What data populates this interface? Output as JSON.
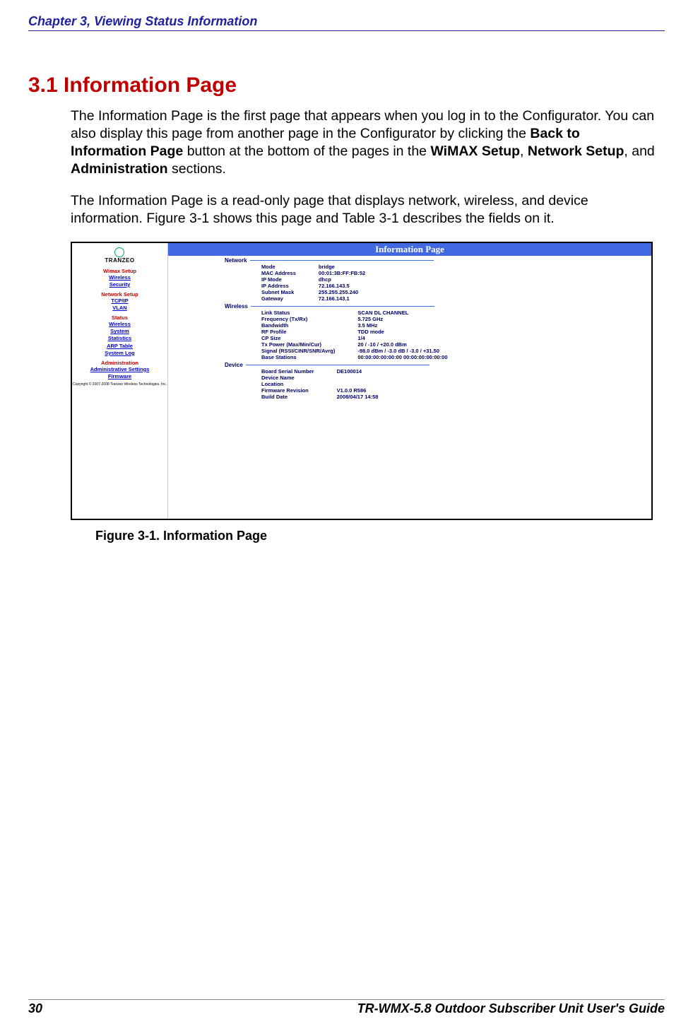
{
  "header": "Chapter 3, Viewing Status Information",
  "h1": "3.1 Information Page",
  "para1_a": "The Information Page is the first page that appears when you log in to the Configurator. You can also display this page from another page in the Configurator by clicking the ",
  "para1_b": "Back to Information Page",
  "para1_c": " button at the bottom of the pages in the ",
  "para1_d": "WiMAX Setup",
  "para1_e": ", ",
  "para1_f": "Network Setup",
  "para1_g": ", and ",
  "para1_h": "Administration",
  "para1_i": " sections.",
  "para2": "The Information Page is a read-only page that displays network, wireless, and device information. Figure 3-1 shows this page and Table 3-1 describes the fields on it.",
  "sidebar": {
    "logo": "TRANZEO",
    "groups": [
      {
        "cat": "Wimax Setup",
        "links": [
          "Wireless",
          "Security"
        ]
      },
      {
        "cat": "Network Setup",
        "links": [
          "TCP/IP",
          "VLAN"
        ]
      },
      {
        "cat": "Status",
        "links": [
          "Wireless",
          "System",
          "Statistics",
          "ARP Table",
          "System Log"
        ]
      },
      {
        "cat": "Administration",
        "links": [
          "Administrative Settings",
          "Firmware"
        ]
      }
    ],
    "copyright": "Copyright © 2007-2008 Tranzeo Wireless Technologies, Inc."
  },
  "chart_data": {
    "type": "table",
    "title": "Information Page",
    "sections": [
      {
        "name": "Network",
        "rows": [
          [
            "Mode",
            "bridge"
          ],
          [
            "MAC Address",
            "00:01:3B:FF:FB:52"
          ],
          [
            "IP Mode",
            "dhcp"
          ],
          [
            "IP Address",
            "72.166.143.5"
          ],
          [
            "Subnet Mask",
            "255.255.255.240"
          ],
          [
            "Gateway",
            "72.166.143.1"
          ]
        ]
      },
      {
        "name": "Wireless",
        "rows": [
          [
            "Link Status",
            "SCAN DL CHANNEL"
          ],
          [
            "Frequency (Tx/Rx)",
            "5.725 GHz"
          ],
          [
            "Bandwidth",
            "3.5 MHz"
          ],
          [
            "RF Profile",
            "TDD mode"
          ],
          [
            "CP Size",
            "1/4"
          ],
          [
            "Tx Power (Max/Min/Cur)",
            "20 / -10 / +20.0 dBm"
          ],
          [
            "Signal (RSSI/CINR/SNR/Avrg)",
            "-98.0 dBm / -3.0 dB / -3.0 / +31.50"
          ],
          [
            "Base Stations",
            "00:00:00:00:00:00 00:00:00:00:00:00"
          ]
        ]
      },
      {
        "name": "Device",
        "rows": [
          [
            "Board Serial Number",
            "DE100014"
          ],
          [
            "Device Name",
            ""
          ],
          [
            "Location",
            ""
          ],
          [
            "Firmware Revision",
            "V1.0.0 R586"
          ],
          [
            "Build Date",
            "2008/04/17 14:58"
          ]
        ]
      }
    ]
  },
  "figure_caption": "Figure 3-1. Information Page",
  "footer_left": "30",
  "footer_right": "TR-WMX-5.8 Outdoor Subscriber Unit User's Guide"
}
